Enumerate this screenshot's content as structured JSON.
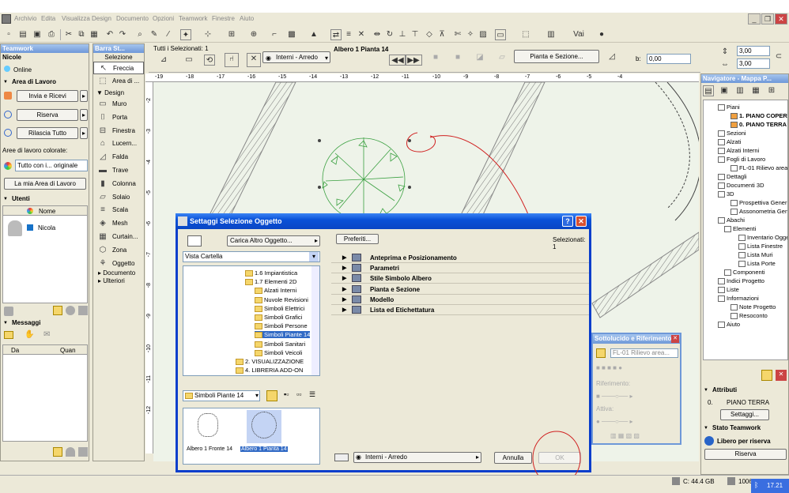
{
  "menubar": {
    "items": [
      "Archivio",
      "Edita",
      "Visualizza",
      "Design",
      "Documento",
      "Opzioni",
      "Teamwork",
      "Finestre",
      "Aiuto"
    ]
  },
  "teamwork": {
    "title": "Teamwork",
    "user": "Nicole",
    "status": "Online",
    "area_lavoro": "Area di Lavoro",
    "invia_ricevi": "Invia e Ricevi",
    "riserva": "Riserva",
    "rilascia_tutto": "Rilascia Tutto",
    "aree_colorate": "Aree di lavoro colorate:",
    "aree_select": "Tutto con i... originale",
    "mia_area": "La mia Area di Lavoro",
    "utenti": "Utenti",
    "nome_col": "Nome",
    "user_row": "Nicola",
    "messaggi": "Messaggi",
    "da_col": "Da",
    "quan_col": "Quan"
  },
  "toolbox": {
    "title": "Barra St...",
    "selezione": "Selezione",
    "freccia": "Freccia",
    "area_tool": "Area di ...",
    "design": "Design",
    "tools": [
      "Muro",
      "Porta",
      "Finestra",
      "Lucern...",
      "Falda",
      "Trave",
      "Colonna",
      "Solaio",
      "Scala",
      "Mesh",
      "Curtain...",
      "Zona",
      "Oggetto"
    ],
    "documento": "Documento",
    "ulteriori": "Ulteriori"
  },
  "infobox": {
    "selected": "Tutti i Selezionati: 1",
    "layer": "Interni - Arredo",
    "object": "Albero 1 Pianta 14",
    "pianta_sezione": "Pianta e Sezione...",
    "b_label": "b:",
    "val_a": "0,00",
    "val_b": "0,00",
    "val_c": "3,00",
    "val_d": "3,00",
    "vai": "Vai"
  },
  "ruler": {
    "top": [
      "-19",
      "-18",
      "-17",
      "-16",
      "-15",
      "-14",
      "-13",
      "-12",
      "-11",
      "-10",
      "-9",
      "-8",
      "-7",
      "-6",
      "-5",
      "-4"
    ],
    "left": [
      "-2",
      "-3",
      "-4",
      "-5",
      "-6",
      "-7",
      "-8",
      "-9",
      "-10",
      "-11",
      "-12"
    ]
  },
  "dialog": {
    "title": "Settaggi Selezione Oggetto",
    "help": "?",
    "close": "✕",
    "carica": "Carica Altro Oggetto...",
    "vista": "Vista Cartella",
    "preferiti": "Preferiti...",
    "selezionati": "Selezionati: 1",
    "tree": [
      "1.6 Impiantistica",
      "1.7 Elementi 2D",
      "Alzati Interni",
      "Nuvole Revisioni",
      "Simboli Elettrici",
      "Simboli Grafici",
      "Simboli Persone",
      "Simboli Piante 14",
      "Simboli Sanitari",
      "Simboli Veicoli",
      "2. VISUALIZZAZIONE",
      "4. LIBRERIA ADD-ON"
    ],
    "folder_select": "Simboli Piante 14",
    "thumb1": "Albero 1 Fronte 14",
    "thumb2": "Albero 1 Pianta 14",
    "categories": [
      "Anteprima e Posizionamento",
      "Parametri",
      "Stile Simbolo Albero",
      "Pianta e Sezione",
      "Modello",
      "Lista ed Etichettatura"
    ],
    "layer_select": "Interni - Arredo",
    "annulla": "Annulla",
    "ok": "OK"
  },
  "sotto": {
    "title": "Sottolucido e Riferimento",
    "ref": "FL-01 Rilievo area...",
    "riferimento": "Riferimento:",
    "attiva": "Attiva:"
  },
  "navigator": {
    "title": "Navigatore - Mappa P...",
    "items": [
      "Piani",
      "1. PIANO COPERTURA",
      "0. PIANO TERRA",
      "Sezioni",
      "Alzati",
      "Alzati Interni",
      "Fogli di Lavoro",
      "FL-01 Rilievo area",
      "Dettagli",
      "Documenti 3D",
      "3D",
      "Prospettiva Generica",
      "Assonometria Generica",
      "Abachi",
      "Elementi",
      "Inventario Oggetti",
      "Lista Finestre",
      "Lista Muri",
      "Lista Porte",
      "Componenti",
      "Indici Progetto",
      "Liste",
      "Informazioni",
      "Note Progetto",
      "Resoconto",
      "Aiuto"
    ],
    "attributi": "Attributi",
    "floor_num": "0.",
    "floor_name": "PIANO TERRA",
    "settaggi": "Settaggi...",
    "stato_tw": "Stato Teamwork",
    "libero": "Libero per riserva",
    "riserva": "Riserva"
  },
  "status": {
    "disk": "C: 44.4 GB",
    "mem": "1006.6 MB",
    "time": "17.21"
  },
  "colors": {
    "accent": "#0a46c4",
    "annotation": "#d02020",
    "tree": "#3aa040"
  }
}
